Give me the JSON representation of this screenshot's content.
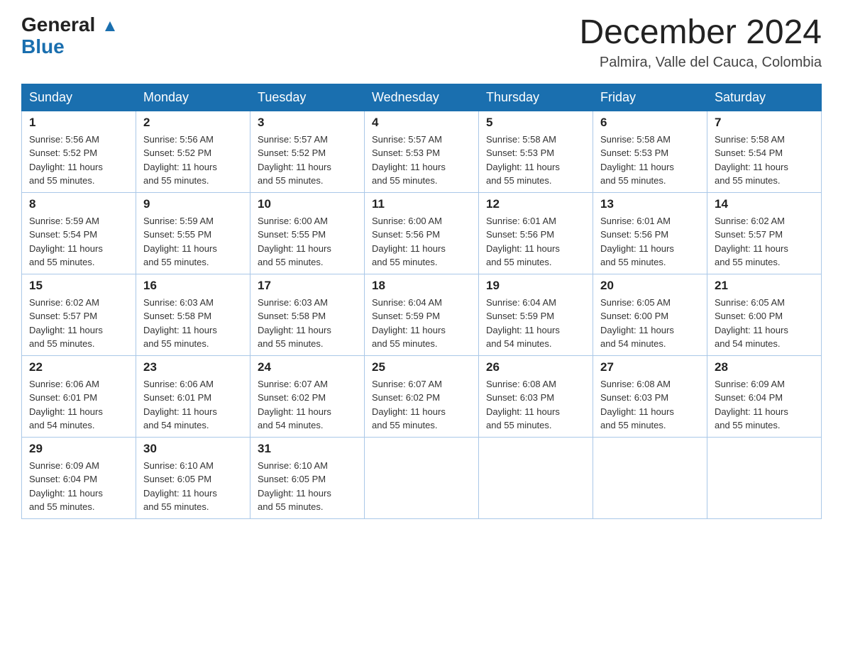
{
  "header": {
    "logo_general": "General",
    "logo_blue": "Blue",
    "month_title": "December 2024",
    "location": "Palmira, Valle del Cauca, Colombia"
  },
  "days_of_week": [
    "Sunday",
    "Monday",
    "Tuesday",
    "Wednesday",
    "Thursday",
    "Friday",
    "Saturday"
  ],
  "weeks": [
    [
      {
        "day": "1",
        "sunrise": "5:56 AM",
        "sunset": "5:52 PM",
        "daylight": "11 hours and 55 minutes."
      },
      {
        "day": "2",
        "sunrise": "5:56 AM",
        "sunset": "5:52 PM",
        "daylight": "11 hours and 55 minutes."
      },
      {
        "day": "3",
        "sunrise": "5:57 AM",
        "sunset": "5:52 PM",
        "daylight": "11 hours and 55 minutes."
      },
      {
        "day": "4",
        "sunrise": "5:57 AM",
        "sunset": "5:53 PM",
        "daylight": "11 hours and 55 minutes."
      },
      {
        "day": "5",
        "sunrise": "5:58 AM",
        "sunset": "5:53 PM",
        "daylight": "11 hours and 55 minutes."
      },
      {
        "day": "6",
        "sunrise": "5:58 AM",
        "sunset": "5:53 PM",
        "daylight": "11 hours and 55 minutes."
      },
      {
        "day": "7",
        "sunrise": "5:58 AM",
        "sunset": "5:54 PM",
        "daylight": "11 hours and 55 minutes."
      }
    ],
    [
      {
        "day": "8",
        "sunrise": "5:59 AM",
        "sunset": "5:54 PM",
        "daylight": "11 hours and 55 minutes."
      },
      {
        "day": "9",
        "sunrise": "5:59 AM",
        "sunset": "5:55 PM",
        "daylight": "11 hours and 55 minutes."
      },
      {
        "day": "10",
        "sunrise": "6:00 AM",
        "sunset": "5:55 PM",
        "daylight": "11 hours and 55 minutes."
      },
      {
        "day": "11",
        "sunrise": "6:00 AM",
        "sunset": "5:56 PM",
        "daylight": "11 hours and 55 minutes."
      },
      {
        "day": "12",
        "sunrise": "6:01 AM",
        "sunset": "5:56 PM",
        "daylight": "11 hours and 55 minutes."
      },
      {
        "day": "13",
        "sunrise": "6:01 AM",
        "sunset": "5:56 PM",
        "daylight": "11 hours and 55 minutes."
      },
      {
        "day": "14",
        "sunrise": "6:02 AM",
        "sunset": "5:57 PM",
        "daylight": "11 hours and 55 minutes."
      }
    ],
    [
      {
        "day": "15",
        "sunrise": "6:02 AM",
        "sunset": "5:57 PM",
        "daylight": "11 hours and 55 minutes."
      },
      {
        "day": "16",
        "sunrise": "6:03 AM",
        "sunset": "5:58 PM",
        "daylight": "11 hours and 55 minutes."
      },
      {
        "day": "17",
        "sunrise": "6:03 AM",
        "sunset": "5:58 PM",
        "daylight": "11 hours and 55 minutes."
      },
      {
        "day": "18",
        "sunrise": "6:04 AM",
        "sunset": "5:59 PM",
        "daylight": "11 hours and 55 minutes."
      },
      {
        "day": "19",
        "sunrise": "6:04 AM",
        "sunset": "5:59 PM",
        "daylight": "11 hours and 54 minutes."
      },
      {
        "day": "20",
        "sunrise": "6:05 AM",
        "sunset": "6:00 PM",
        "daylight": "11 hours and 54 minutes."
      },
      {
        "day": "21",
        "sunrise": "6:05 AM",
        "sunset": "6:00 PM",
        "daylight": "11 hours and 54 minutes."
      }
    ],
    [
      {
        "day": "22",
        "sunrise": "6:06 AM",
        "sunset": "6:01 PM",
        "daylight": "11 hours and 54 minutes."
      },
      {
        "day": "23",
        "sunrise": "6:06 AM",
        "sunset": "6:01 PM",
        "daylight": "11 hours and 54 minutes."
      },
      {
        "day": "24",
        "sunrise": "6:07 AM",
        "sunset": "6:02 PM",
        "daylight": "11 hours and 54 minutes."
      },
      {
        "day": "25",
        "sunrise": "6:07 AM",
        "sunset": "6:02 PM",
        "daylight": "11 hours and 55 minutes."
      },
      {
        "day": "26",
        "sunrise": "6:08 AM",
        "sunset": "6:03 PM",
        "daylight": "11 hours and 55 minutes."
      },
      {
        "day": "27",
        "sunrise": "6:08 AM",
        "sunset": "6:03 PM",
        "daylight": "11 hours and 55 minutes."
      },
      {
        "day": "28",
        "sunrise": "6:09 AM",
        "sunset": "6:04 PM",
        "daylight": "11 hours and 55 minutes."
      }
    ],
    [
      {
        "day": "29",
        "sunrise": "6:09 AM",
        "sunset": "6:04 PM",
        "daylight": "11 hours and 55 minutes."
      },
      {
        "day": "30",
        "sunrise": "6:10 AM",
        "sunset": "6:05 PM",
        "daylight": "11 hours and 55 minutes."
      },
      {
        "day": "31",
        "sunrise": "6:10 AM",
        "sunset": "6:05 PM",
        "daylight": "11 hours and 55 minutes."
      },
      null,
      null,
      null,
      null
    ]
  ],
  "labels": {
    "sunrise": "Sunrise:",
    "sunset": "Sunset:",
    "daylight": "Daylight:"
  }
}
